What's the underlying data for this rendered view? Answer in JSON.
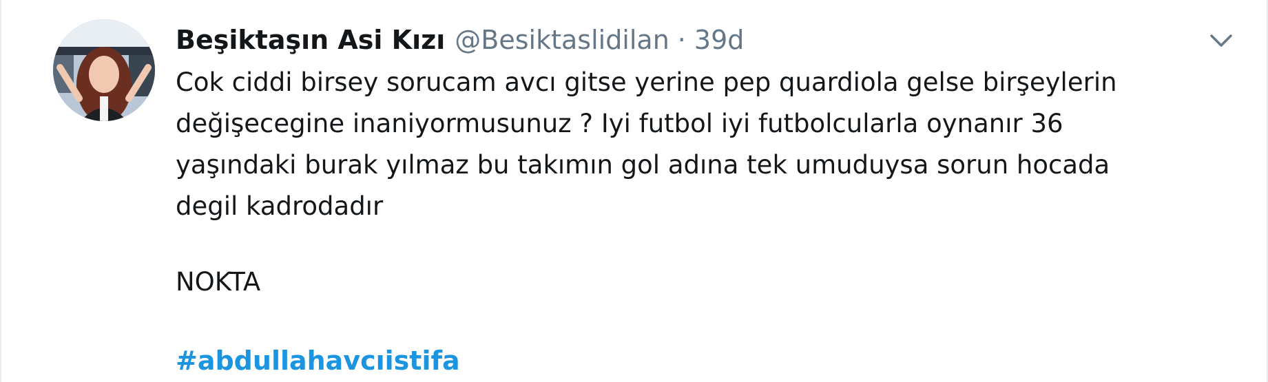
{
  "tweet": {
    "display_name": "Beşiktaşın Asi Kızı",
    "handle": "@Besiktaslidilan",
    "separator": "·",
    "time": "39d",
    "body_lines": "Cok ciddi birsey sorucam avcı gitse yerine pep quardiola gelse birşeylerin\ndeğişecegine inaniyormusunuz ? Iyi futbol iyi futbolcularla oynanır 36\nyaşındaki burak yılmaz bu takımın gol adına tek umuduysa sorun hocada\ndegil kadrodadır",
    "closing": "NOKTA",
    "hashtag": "#abdullahavcıistifa"
  },
  "icons": {
    "menu": "chevron-down-icon",
    "avatar": "profile-photo"
  },
  "colors": {
    "name": "#14171a",
    "muted": "#657786",
    "hashtag": "#1b95e0",
    "border": "#e6ecf0"
  }
}
